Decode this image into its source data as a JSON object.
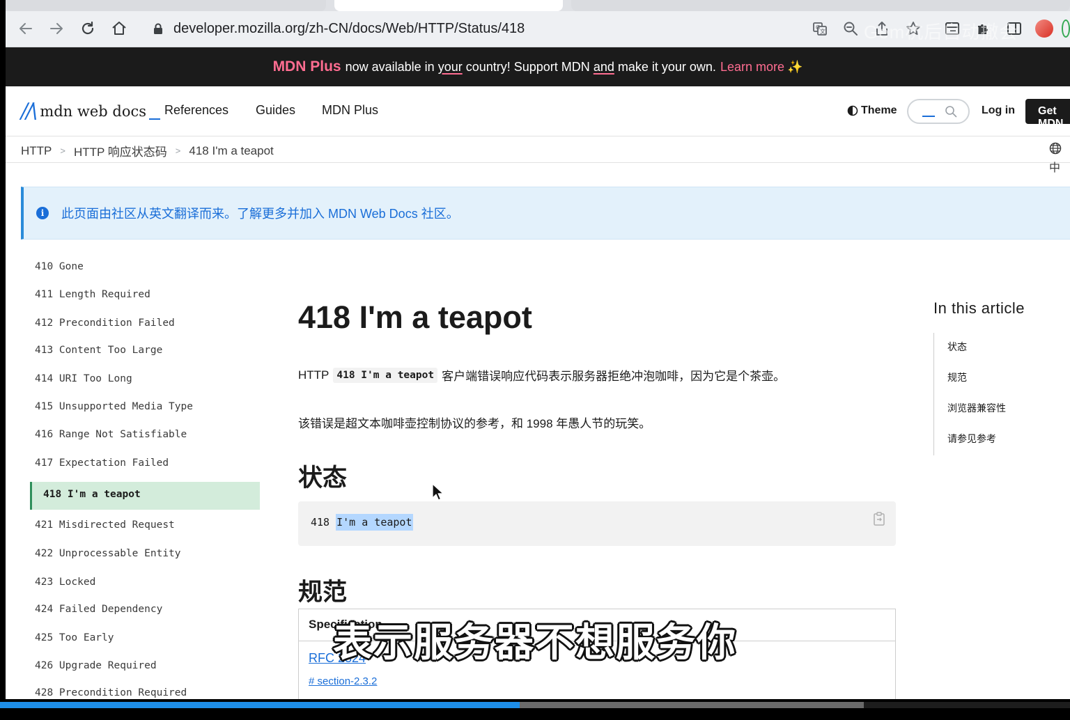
{
  "browser": {
    "url": "developer.mozilla.org/zh-CN/docs/Web/HTTP/Status/418",
    "watermark": "Gem杭后自动撤会"
  },
  "banner": {
    "plus": "MDN Plus",
    "part1": "now available in",
    "your": "your",
    "part2": "country! Support MDN",
    "and": "and",
    "part3": "make it your own.",
    "learn_more": "Learn more",
    "sparkle": "✨"
  },
  "header": {
    "logo_text": "mdn web docs",
    "nav": [
      "References",
      "Guides",
      "MDN Plus"
    ],
    "theme": "Theme",
    "login": "Log in",
    "get_mdn": "Get MDN"
  },
  "breadcrumb": [
    "HTTP",
    "HTTP 响应状态码",
    "418 I'm a teapot"
  ],
  "language_hint": "中",
  "notice": "此页面由社区从英文翻译而来。了解更多并加入 MDN Web Docs 社区。",
  "sidebar": {
    "items": [
      "410 Gone",
      "411 Length Required",
      "412 Precondition Failed",
      "413 Content Too Large",
      "414 URI Too Long",
      "415 Unsupported Media Type",
      "416 Range Not Satisfiable",
      "417 Expectation Failed",
      "418 I'm a teapot",
      "421 Misdirected Request",
      "422 Unprocessable Entity",
      "423 Locked",
      "424 Failed Dependency",
      "425 Too Early",
      "426 Upgrade Required",
      "428 Precondition Required"
    ],
    "active": "418 I'm a teapot"
  },
  "main": {
    "title": "418 I'm a teapot",
    "p1_before": "HTTP",
    "p1_code": "418 I'm a teapot",
    "p1_after": "客户端错误响应代码表示服务器拒绝冲泡咖啡，因为它是个茶壶。",
    "p2": "该错误是超文本咖啡壶控制协议的参考，和 1998 年愚人节的玩笑。",
    "status_heading": "状态",
    "code_prefix": "418",
    "code_selected": "I'm a teapot",
    "spec_heading": "规范",
    "spec_table_header": "Specification",
    "spec_link": "RFC 2324",
    "spec_section": "# section-2.3.2"
  },
  "toc": {
    "heading": "In this article",
    "items": [
      "状态",
      "规范",
      "浏览器兼容性",
      "请参见参考"
    ]
  },
  "subtitle": "表示服务器不想服务你",
  "video": {
    "played_fraction": 0.486,
    "buffered_fraction": 0.807
  },
  "colors": {
    "accent_blue": "#1a6ed8",
    "mdn_plus_pink": "#ff6d91",
    "active_green": "#d3ecdb",
    "progress_blue": "#1e8ee8"
  }
}
